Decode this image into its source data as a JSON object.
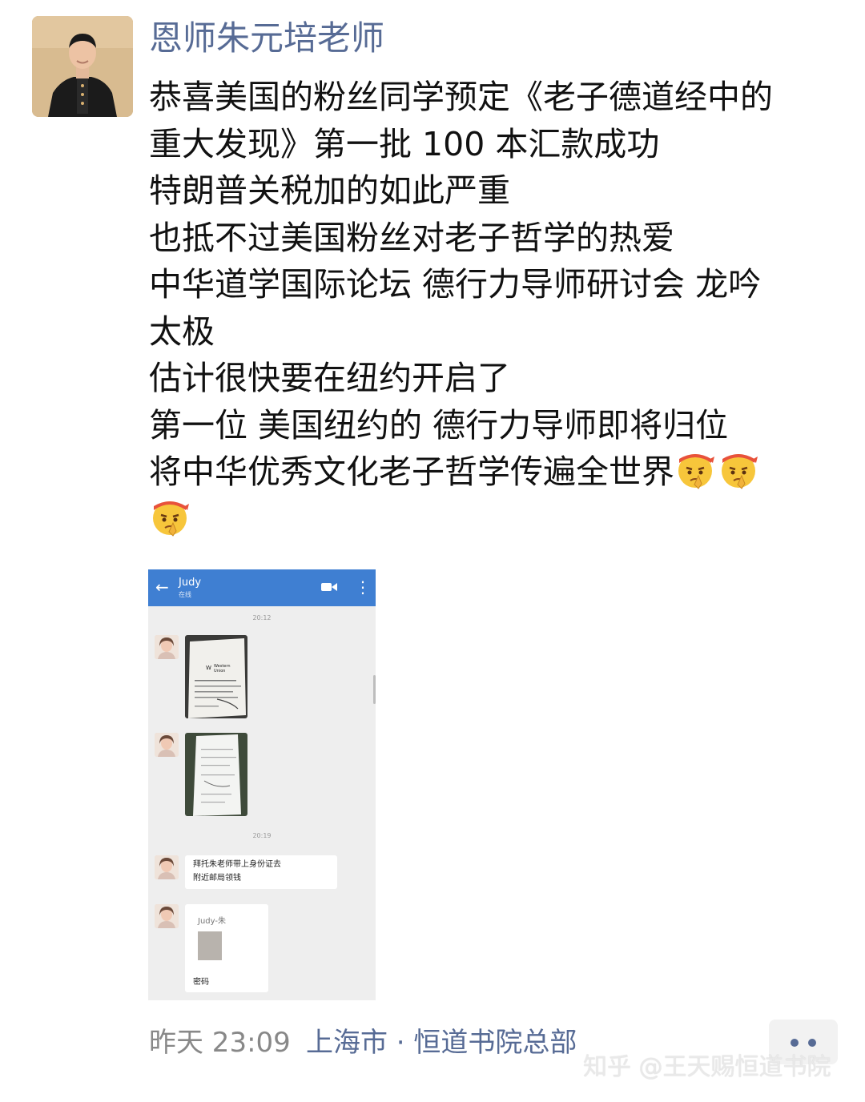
{
  "post": {
    "author": "恩师朱元培老师",
    "lines": [
      "恭喜美国的粉丝同学预定《老子德道经中的",
      "重大发现》第一批 100 本汇款成功",
      "特朗普关税加的如此严重",
      "也抵不过美国粉丝对老子哲学的热爱",
      "中华道学国际论坛 德行力导师研讨会 龙吟",
      "太极",
      "估计很快要在纽约开启了",
      "第一位 美国纽约的 德行力导师即将归位",
      "将中华优秀文化老子哲学传遍全世界"
    ],
    "emoji_name": "shushing-face-emoji",
    "emoji_count": 3
  },
  "attachment": {
    "header_name": "Judy",
    "header_sub": "在线",
    "time_1": "20:12",
    "time_2": "20:19",
    "bubble_line_1": "拜托朱老师带上身份证去",
    "bubble_line_2": "附近邮局领钱",
    "card_name": "Judy-朱",
    "card_label": "密码",
    "photo_1_brand": "Western Union"
  },
  "footer": {
    "time": "昨天 23:09",
    "location": "上海市 · 恒道书院总部",
    "more_icon": "more-dots-icon"
  },
  "watermark": "知乎 @王天赐恒道书院",
  "colors": {
    "name_blue": "#576b95",
    "header_blue": "#3f7fd2",
    "text": "#111111",
    "muted": "#888888"
  }
}
